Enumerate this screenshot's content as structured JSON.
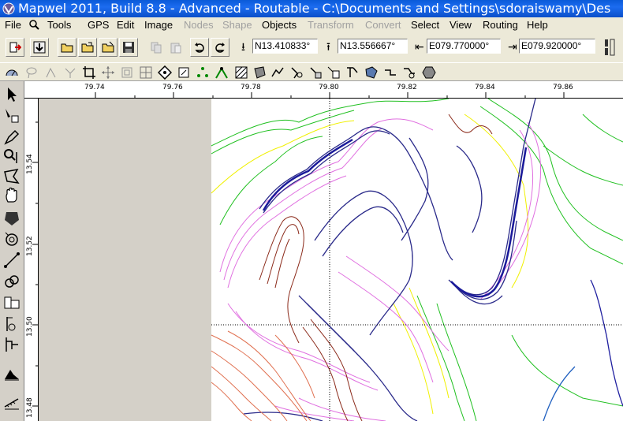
{
  "window": {
    "title": "Mapwel 2011, Build 8.8 - Advanced - Routable - C:\\Documents and Settings\\sdoraiswamy\\Des"
  },
  "menu": [
    {
      "label": "File",
      "enabled": true
    },
    {
      "label": "Tools",
      "enabled": true
    },
    {
      "label": "GPS",
      "enabled": true
    },
    {
      "label": "Edit",
      "enabled": true
    },
    {
      "label": "Image",
      "enabled": true
    },
    {
      "label": "Nodes",
      "enabled": false
    },
    {
      "label": "Shape",
      "enabled": false
    },
    {
      "label": "Objects",
      "enabled": true
    },
    {
      "label": "Transform",
      "enabled": false
    },
    {
      "label": "Convert",
      "enabled": false
    },
    {
      "label": "Select",
      "enabled": true
    },
    {
      "label": "View",
      "enabled": true
    },
    {
      "label": "Routing",
      "enabled": true
    },
    {
      "label": "Help",
      "enabled": true
    }
  ],
  "coords": {
    "south": "N13.410833°",
    "north": "N13.556667°",
    "west": "E079.770000°",
    "east": "E079.920000°"
  },
  "ruler": {
    "x_ticks": [
      "79.74",
      "79.76",
      "79.78",
      "79.80",
      "79.82",
      "79.84",
      "79.86"
    ],
    "y_ticks": [
      "13.54",
      "13.52",
      "13.50",
      "13.48"
    ]
  },
  "colors": {
    "titlebar": "#0b55d6",
    "contour_blue": "#1a1aa0",
    "contour_navy": "#2a2a6a",
    "contour_magenta": "#d040d0",
    "contour_pink": "#f0a0e8",
    "contour_yellow": "#f0f000",
    "contour_green": "#20c020",
    "contour_brown": "#8b2a1a",
    "contour_orange": "#e07050"
  }
}
